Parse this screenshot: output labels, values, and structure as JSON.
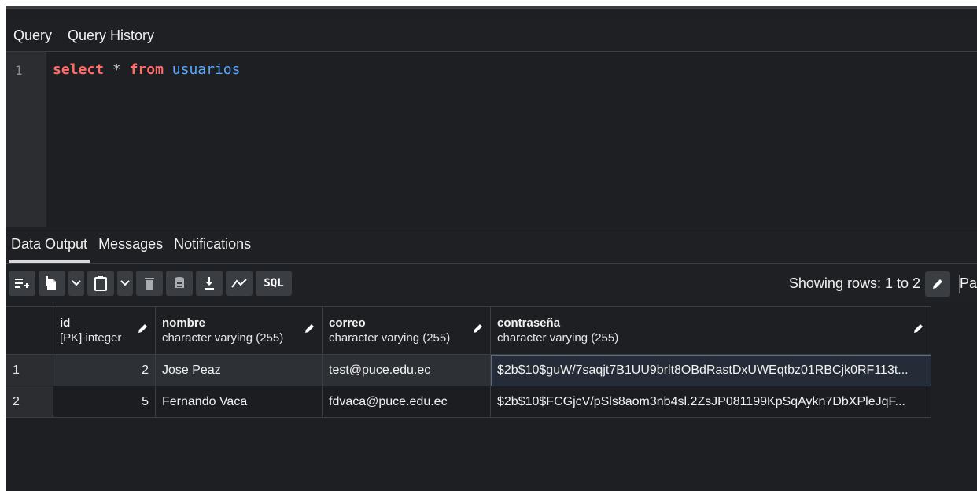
{
  "query_tabs": [
    "Query",
    "Query History"
  ],
  "editor": {
    "line_number": "1",
    "tokens": {
      "select": "select",
      "star": "*",
      "from": "from",
      "table": "usuarios"
    }
  },
  "output_tabs": [
    "Data Output",
    "Messages",
    "Notifications"
  ],
  "toolbar": {
    "sql_label": "SQL",
    "rows_info": "Showing rows: 1 to 2",
    "pagination_label": "Pa"
  },
  "grid": {
    "columns": [
      {
        "name": "id",
        "type": "[PK] integer"
      },
      {
        "name": "nombre",
        "type": "character varying (255)"
      },
      {
        "name": "correo",
        "type": "character varying (255)"
      },
      {
        "name": "contraseña",
        "type": "character varying (255)"
      }
    ],
    "rows": [
      {
        "rownum": "1",
        "id": "2",
        "nombre": "Jose Peaz",
        "correo": "test@puce.edu.ec",
        "contrasena": "$2b$10$guW/7saqjt7B1UU9brlt8OBdRastDxUWEqtbz01RBCjk0RF113t..."
      },
      {
        "rownum": "2",
        "id": "5",
        "nombre": "Fernando Vaca",
        "correo": "fdvaca@puce.edu.ec",
        "contrasena": "$2b$10$FCGjcV/pSls8aom3nb4sl.2ZsJP081199KpSqAykn7DbXPleJqF..."
      }
    ]
  },
  "colors": {
    "background": "#1e1f22",
    "keyword": "#ff6b68",
    "identifier": "#5aa8ff"
  }
}
